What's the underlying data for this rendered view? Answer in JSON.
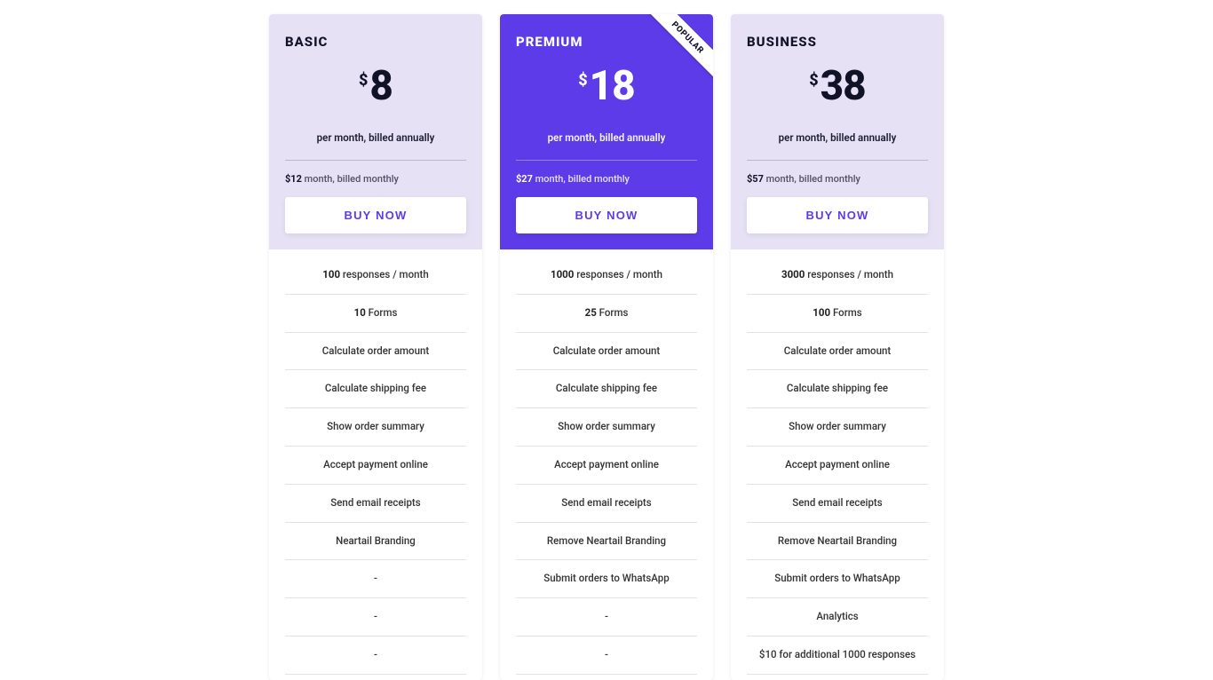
{
  "currency_symbol": "$",
  "buy_label": "BUY NOW",
  "popular_label": "POPULAR",
  "plans": [
    {
      "id": "basic",
      "title": "BASIC",
      "price": "8",
      "billing_annual": "per month, billed annually",
      "monthly_price": "$12",
      "monthly_rest": "month, billed monthly",
      "theme": "light",
      "popular": false,
      "features": [
        {
          "bold": "100",
          "rest": " responses / month"
        },
        {
          "bold": "10",
          "rest": " Forms"
        },
        {
          "text": "Calculate order amount"
        },
        {
          "text": "Calculate shipping fee"
        },
        {
          "text": "Show order summary"
        },
        {
          "text": "Accept payment online"
        },
        {
          "text": "Send email receipts"
        },
        {
          "text": "Neartail Branding"
        },
        {
          "text": "-"
        },
        {
          "text": "-"
        },
        {
          "text": "-"
        }
      ]
    },
    {
      "id": "premium",
      "title": "PREMIUM",
      "price": "18",
      "billing_annual": "per month, billed annually",
      "monthly_price": "$27",
      "monthly_rest": "month, billed monthly",
      "theme": "purple",
      "popular": true,
      "features": [
        {
          "bold": "1000",
          "rest": " responses / month"
        },
        {
          "bold": "25",
          "rest": " Forms"
        },
        {
          "text": "Calculate order amount"
        },
        {
          "text": "Calculate shipping fee"
        },
        {
          "text": "Show order summary"
        },
        {
          "text": "Accept payment online"
        },
        {
          "text": "Send email receipts"
        },
        {
          "text": "Remove Neartail Branding"
        },
        {
          "text": "Submit orders to WhatsApp"
        },
        {
          "text": "-"
        },
        {
          "text": "-"
        }
      ]
    },
    {
      "id": "business",
      "title": "BUSINESS",
      "price": "38",
      "billing_annual": "per month, billed annually",
      "monthly_price": "$57",
      "monthly_rest": "month, billed monthly",
      "theme": "light",
      "popular": false,
      "features": [
        {
          "bold": "3000",
          "rest": " responses / month"
        },
        {
          "bold": "100",
          "rest": " Forms"
        },
        {
          "text": "Calculate order amount"
        },
        {
          "text": "Calculate shipping fee"
        },
        {
          "text": "Show order summary"
        },
        {
          "text": "Accept payment online"
        },
        {
          "text": "Send email receipts"
        },
        {
          "text": "Remove Neartail Branding"
        },
        {
          "text": "Submit orders to WhatsApp"
        },
        {
          "text": "Analytics"
        },
        {
          "text": "$10 for additional 1000 responses"
        }
      ]
    }
  ]
}
